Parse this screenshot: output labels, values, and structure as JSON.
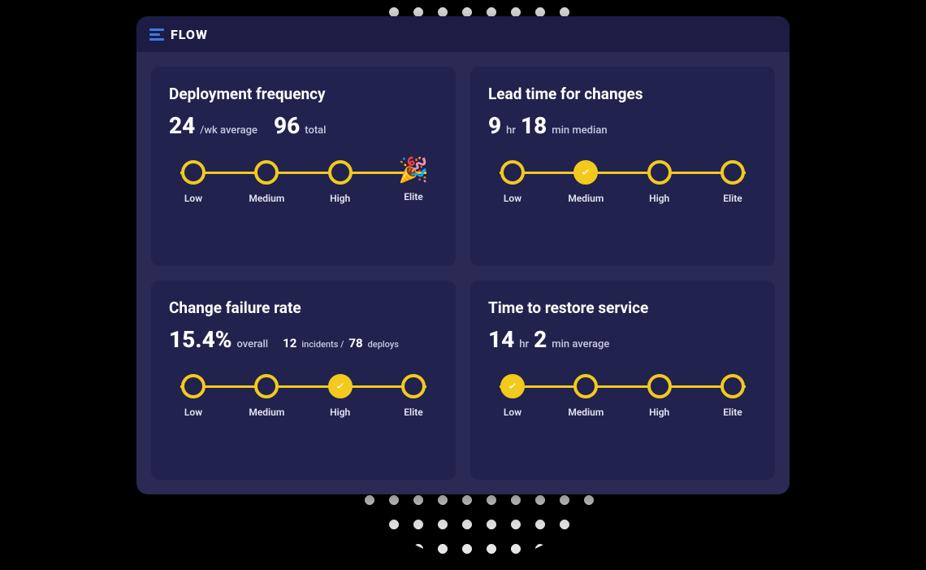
{
  "app": {
    "title": "FLOW"
  },
  "gauge_levels": [
    "Low",
    "Medium",
    "High",
    "Elite"
  ],
  "cards": {
    "deploy_freq": {
      "title": "Deployment frequency",
      "value1": "24",
      "unit1": "/wk average",
      "value2": "96",
      "unit2": "total",
      "level": 3,
      "celebrate": true
    },
    "lead_time": {
      "title": "Lead time for changes",
      "value1": "9",
      "unit1": "hr",
      "value2": "18",
      "unit2": "min median",
      "level": 1,
      "celebrate": false
    },
    "change_fail": {
      "title": "Change failure rate",
      "value1": "15.4%",
      "unit1": "overall",
      "sub_n1": "12",
      "sub_u1": "incidents /",
      "sub_n2": "78",
      "sub_u2": "deploys",
      "level": 2,
      "celebrate": false
    },
    "restore": {
      "title": "Time to restore service",
      "value1": "14",
      "unit1": "hr",
      "value2": "2",
      "unit2": "min average",
      "level": 0,
      "celebrate": false
    }
  },
  "icons": {
    "celebrate": "🎉"
  }
}
